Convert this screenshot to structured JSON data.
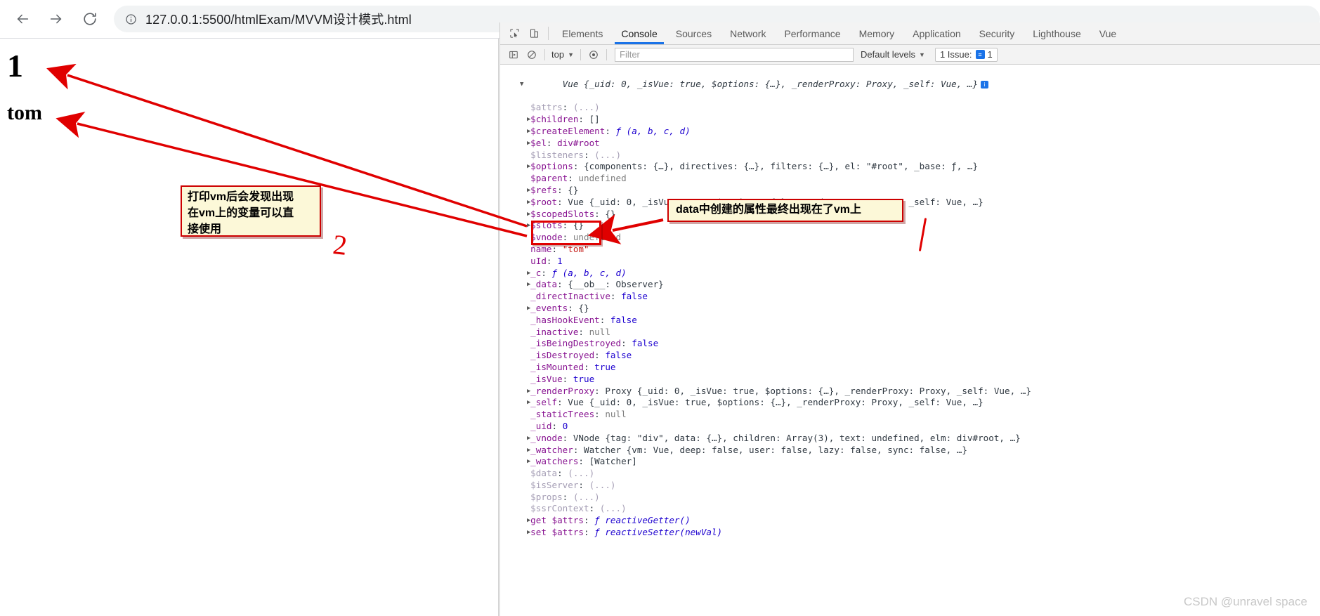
{
  "browser": {
    "back_label": "Back",
    "forward_label": "Forward",
    "reload_label": "Reload",
    "site_info_label": "View site information",
    "url": "127.0.0.1:5500/htmlExam/MVVM设计模式.html"
  },
  "page": {
    "heading_number": "1",
    "heading_name": "tom"
  },
  "devtools": {
    "inspect_label": "Inspect element",
    "device_toolbar_label": "Toggle device toolbar",
    "tabs": [
      {
        "label": "Elements",
        "active": false
      },
      {
        "label": "Console",
        "active": true
      },
      {
        "label": "Sources",
        "active": false
      },
      {
        "label": "Network",
        "active": false
      },
      {
        "label": "Performance",
        "active": false
      },
      {
        "label": "Memory",
        "active": false
      },
      {
        "label": "Application",
        "active": false
      },
      {
        "label": "Security",
        "active": false
      },
      {
        "label": "Lighthouse",
        "active": false
      },
      {
        "label": "Vue",
        "active": false
      }
    ],
    "filterbar": {
      "sidebar_label": "Show console sidebar",
      "clear_label": "Clear console",
      "context": "top",
      "eye_label": "Create live expression",
      "filter_placeholder": "Filter",
      "levels": "Default levels",
      "issues_label": "1 Issue:",
      "issues_count": "1"
    },
    "console": {
      "root_line": {
        "expander": "▼",
        "cls": "Vue",
        "preview": "{_uid: 0, _isVue: true, $options: {…}, _renderProxy: Proxy, _self: Vue, …}",
        "badge": "i"
      },
      "lines": [
        {
          "expander": "",
          "key": "$attrs",
          "sep": ": ",
          "value": "(...)",
          "vtype": "dim"
        },
        {
          "expander": "▶",
          "key": "$children",
          "sep": ": ",
          "value": "[]",
          "vtype": "plain"
        },
        {
          "expander": "▶",
          "key": "$createElement",
          "sep": ": ",
          "value": "ƒ (a, b, c, d)",
          "vtype": "fn"
        },
        {
          "expander": "▶",
          "key": "$el",
          "sep": ": ",
          "value": "div#root",
          "vtype": "name"
        },
        {
          "expander": "",
          "key": "$listeners",
          "sep": ": ",
          "value": "(...)",
          "vtype": "dim"
        },
        {
          "expander": "▶",
          "key": "$options",
          "sep": ": ",
          "value": "{components: {…}, directives: {…}, filters: {…}, el: \"#root\", _base: ƒ, …}",
          "vtype": "obj"
        },
        {
          "expander": "",
          "key": "$parent",
          "sep": ": ",
          "value": "undefined",
          "vtype": "undef"
        },
        {
          "expander": "▶",
          "key": "$refs",
          "sep": ": ",
          "value": "{}",
          "vtype": "plain"
        },
        {
          "expander": "▶",
          "key": "$root",
          "sep": ": ",
          "value": "Vue {_uid: 0, _isVue: true, $options: {…}, _renderProxy: Proxy, _self: Vue, …}",
          "vtype": "obj"
        },
        {
          "expander": "▶",
          "key": "$scopedSlots",
          "sep": ": ",
          "value": "{}",
          "vtype": "plain"
        },
        {
          "expander": "▶",
          "key": "$slots",
          "sep": ": ",
          "value": "{}",
          "vtype": "plain"
        },
        {
          "expander": "",
          "key": "$vnode",
          "sep": ": ",
          "value": "undefined",
          "vtype": "undef"
        },
        {
          "expander": "",
          "key": "name",
          "sep": ": ",
          "value": "\"tom\"",
          "vtype": "str",
          "highlighted": true
        },
        {
          "expander": "",
          "key": "uId",
          "sep": ": ",
          "value": "1",
          "vtype": "num",
          "highlighted": true
        },
        {
          "expander": "▶",
          "key": "_c",
          "sep": ": ",
          "value": "ƒ (a, b, c, d)",
          "vtype": "fn"
        },
        {
          "expander": "▶",
          "key": "_data",
          "sep": ": ",
          "value": "{__ob__: Observer}",
          "vtype": "obj"
        },
        {
          "expander": "",
          "key": "_directInactive",
          "sep": ": ",
          "value": "false",
          "vtype": "bool"
        },
        {
          "expander": "▶",
          "key": "_events",
          "sep": ": ",
          "value": "{}",
          "vtype": "plain"
        },
        {
          "expander": "",
          "key": "_hasHookEvent",
          "sep": ": ",
          "value": "false",
          "vtype": "bool"
        },
        {
          "expander": "",
          "key": "_inactive",
          "sep": ": ",
          "value": "null",
          "vtype": "null"
        },
        {
          "expander": "",
          "key": "_isBeingDestroyed",
          "sep": ": ",
          "value": "false",
          "vtype": "bool"
        },
        {
          "expander": "",
          "key": "_isDestroyed",
          "sep": ": ",
          "value": "false",
          "vtype": "bool"
        },
        {
          "expander": "",
          "key": "_isMounted",
          "sep": ": ",
          "value": "true",
          "vtype": "bool"
        },
        {
          "expander": "",
          "key": "_isVue",
          "sep": ": ",
          "value": "true",
          "vtype": "bool"
        },
        {
          "expander": "▶",
          "key": "_renderProxy",
          "sep": ": ",
          "value": "Proxy {_uid: 0, _isVue: true, $options: {…}, _renderProxy: Proxy, _self: Vue, …}",
          "vtype": "obj"
        },
        {
          "expander": "▶",
          "key": "_self",
          "sep": ": ",
          "value": "Vue {_uid: 0, _isVue: true, $options: {…}, _renderProxy: Proxy, _self: Vue, …}",
          "vtype": "obj"
        },
        {
          "expander": "",
          "key": "_staticTrees",
          "sep": ": ",
          "value": "null",
          "vtype": "null"
        },
        {
          "expander": "",
          "key": "_uid",
          "sep": ": ",
          "value": "0",
          "vtype": "num"
        },
        {
          "expander": "▶",
          "key": "_vnode",
          "sep": ": ",
          "value": "VNode {tag: \"div\", data: {…}, children: Array(3), text: undefined, elm: div#root, …}",
          "vtype": "obj"
        },
        {
          "expander": "▶",
          "key": "_watcher",
          "sep": ": ",
          "value": "Watcher {vm: Vue, deep: false, user: false, lazy: false, sync: false, …}",
          "vtype": "obj"
        },
        {
          "expander": "▶",
          "key": "_watchers",
          "sep": ": ",
          "value": "[Watcher]",
          "vtype": "plain"
        },
        {
          "expander": "",
          "key": "$data",
          "sep": ": ",
          "value": "(...)",
          "vtype": "dim"
        },
        {
          "expander": "",
          "key": "$isServer",
          "sep": ": ",
          "value": "(...)",
          "vtype": "dim"
        },
        {
          "expander": "",
          "key": "$props",
          "sep": ": ",
          "value": "(...)",
          "vtype": "dim"
        },
        {
          "expander": "",
          "key": "$ssrContext",
          "sep": ": ",
          "value": "(...)",
          "vtype": "dim"
        },
        {
          "expander": "▶",
          "key": "get $attrs",
          "sep": ": ",
          "value": "ƒ reactiveGetter()",
          "vtype": "fn"
        },
        {
          "expander": "▶",
          "key": "set $attrs",
          "sep": ": ",
          "value": "ƒ reactiveSetter(newVal)",
          "vtype": "fn"
        }
      ]
    }
  },
  "annotations": {
    "note_1": "打印vm后会发现出现在vm上的变量可以直接使用",
    "note_1_lines": [
      "打印vm后会发现出现",
      "在vm上的变量可以直",
      "接使用"
    ],
    "note_2": "data中创建的属性最终出现在了vm上",
    "marker_2": "2"
  },
  "watermark": "CSDN @unravel space"
}
